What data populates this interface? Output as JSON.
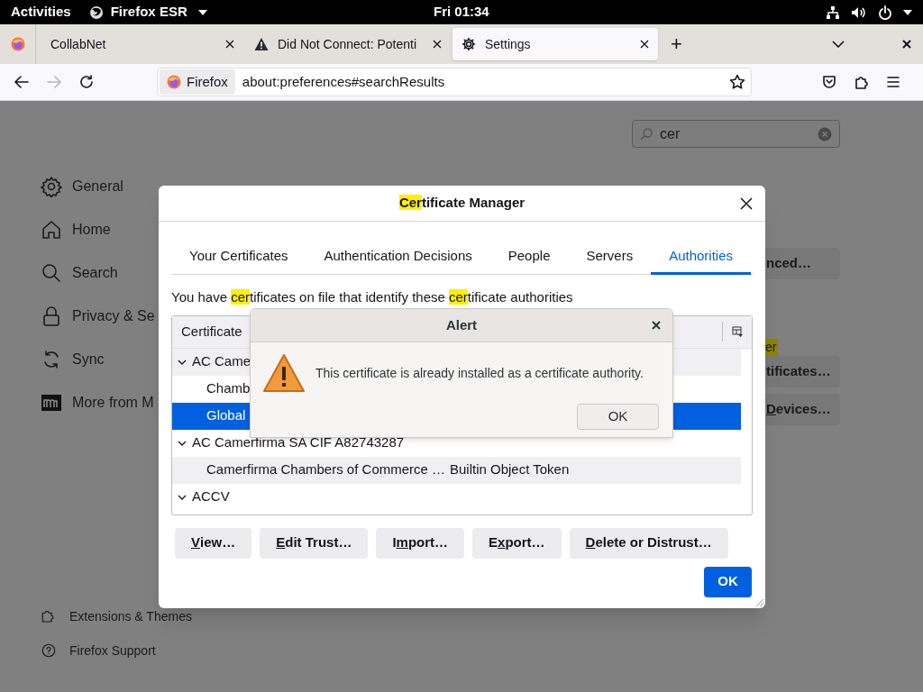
{
  "top_bar": {
    "activities": "Activities",
    "app_menu": "Firefox ESR",
    "clock": "Fri 01:34"
  },
  "tabs": [
    {
      "kind": "pinned",
      "selected": false
    },
    {
      "kind": "page",
      "label": "CollabNet",
      "selected": false
    },
    {
      "kind": "page",
      "label": "Did Not Connect: Potenti",
      "selected": false
    },
    {
      "kind": "page",
      "label": "Settings",
      "selected": true
    }
  ],
  "new_tab": "+",
  "nav": {
    "identity": "Firefox",
    "url": "about:preferences#searchResults",
    "forward_disabled": true
  },
  "settings": {
    "search": {
      "value": "cer"
    },
    "sidebar": [
      {
        "label": "General"
      },
      {
        "label": "Home"
      },
      {
        "label": "Search"
      },
      {
        "label": "Privacy & Se"
      },
      {
        "label": "Sync"
      },
      {
        "label": "More from M"
      }
    ],
    "footer_links": [
      {
        "label": "Extensions & Themes"
      },
      {
        "label": "Firefox Support"
      }
    ],
    "behind_buttons": [
      {
        "parts": [
          {
            "text": "nced…",
            "underlined": false
          }
        ]
      },
      {
        "parts": [
          {
            "text": "tificates…",
            "underlined": false
          }
        ]
      },
      {
        "parts": [
          {
            "text": "D",
            "underlined": true
          },
          {
            "text": "evices…",
            "underlined": false
          }
        ]
      }
    ],
    "behind_highlight": "er"
  },
  "certificate_manager": {
    "title": [
      {
        "text": "Cer",
        "highlight": true
      },
      {
        "text": "tificate Manager",
        "highlight": false
      }
    ],
    "tabs": [
      {
        "label": "Your Certificates",
        "selected": false
      },
      {
        "label": "Authentication Decisions",
        "selected": false
      },
      {
        "label": "People",
        "selected": false
      },
      {
        "label": "Servers",
        "selected": false
      },
      {
        "label": "Authorities",
        "selected": true
      }
    ],
    "description": [
      {
        "text": "You have ",
        "highlight": false
      },
      {
        "text": "cer",
        "highlight": true
      },
      {
        "text": "tificates on file that identify these ",
        "highlight": false
      },
      {
        "text": "cer",
        "highlight": true
      },
      {
        "text": "tificate authorities",
        "highlight": false
      }
    ],
    "column_1": "Certificate",
    "rows": [
      {
        "name": "AC Came",
        "expanded": true,
        "selected": false,
        "children": [
          {
            "name": "Chamb",
            "selected": false
          },
          {
            "name": "Global",
            "selected": true
          }
        ]
      },
      {
        "name": "AC Camerfirma SA CIF A82743287",
        "expanded": true,
        "selected": false,
        "children": [
          {
            "name": "Camerfirma Chambers of Commerce …",
            "token": "Builtin Object Token",
            "selected": false
          }
        ]
      },
      {
        "name": "ACCV",
        "expanded": true,
        "selected": false
      }
    ],
    "buttons": [
      {
        "parts": [
          {
            "text": "V",
            "underlined": true
          },
          {
            "text": "iew…",
            "underlined": false
          }
        ]
      },
      {
        "parts": [
          {
            "text": "E",
            "underlined": true
          },
          {
            "text": "dit Trust…",
            "underlined": false
          }
        ]
      },
      {
        "parts": [
          {
            "text": "I",
            "underlined": false
          },
          {
            "text": "m",
            "underlined": true
          },
          {
            "text": "port…",
            "underlined": false
          }
        ]
      },
      {
        "parts": [
          {
            "text": "E",
            "underlined": false
          },
          {
            "text": "x",
            "underlined": true
          },
          {
            "text": "port…",
            "underlined": false
          }
        ]
      },
      {
        "parts": [
          {
            "text": "D",
            "underlined": true
          },
          {
            "text": "elete or Distrust…",
            "underlined": false
          }
        ]
      }
    ],
    "ok": "OK"
  },
  "alert": {
    "title": "Alert",
    "message": "This certificate is already installed as a certificate authority.",
    "ok": "OK"
  }
}
